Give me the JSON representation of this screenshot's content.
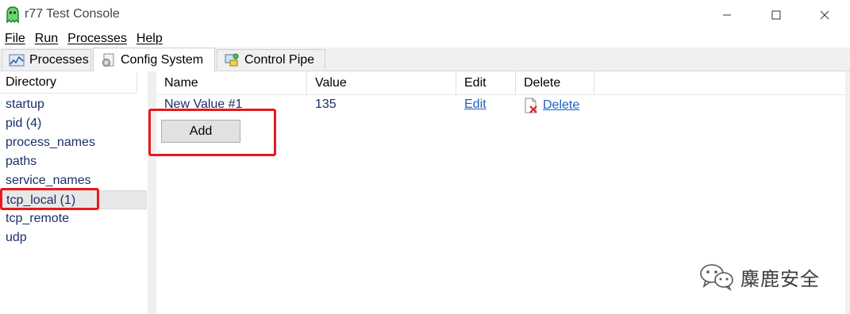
{
  "window": {
    "title": "r77 Test Console",
    "icon": "ghost-icon",
    "controls": [
      "minimize-icon",
      "maximize-icon",
      "close-icon"
    ]
  },
  "menu": {
    "items": [
      "File",
      "Run",
      "Processes",
      "Help"
    ]
  },
  "tabs": [
    {
      "label": "Processes",
      "icon": "chart-icon",
      "active": false
    },
    {
      "label": "Config System",
      "icon": "gear-document-icon",
      "active": true
    },
    {
      "label": "Control Pipe",
      "icon": "pipe-icon",
      "active": false
    }
  ],
  "directory": {
    "header": "Directory",
    "items": [
      "startup",
      "pid (4)",
      "process_names",
      "paths",
      "service_names",
      "tcp_local (1)",
      "tcp_remote",
      "udp"
    ],
    "selected": "tcp_local (1)"
  },
  "grid": {
    "columns": [
      "Name",
      "Value",
      "Edit",
      "Delete"
    ],
    "rows": [
      {
        "name": "New Value #1",
        "value": "135",
        "edit": "Edit",
        "delete": "Delete"
      }
    ]
  },
  "add_button": "Add",
  "watermark": {
    "text": "麋鹿安全",
    "icon": "wechat-icon"
  },
  "colors": {
    "highlight": "#e8191c",
    "link": "#1f5fbf",
    "item_text": "#1a2f6b"
  }
}
